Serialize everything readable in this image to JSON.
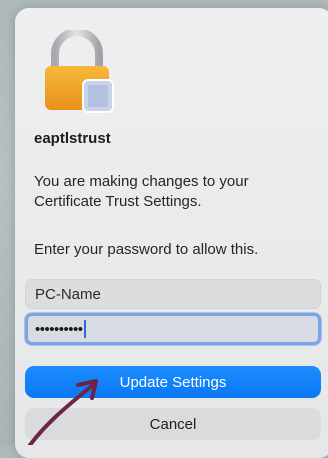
{
  "dialog": {
    "app_name": "eaptlstrust",
    "message": "You are making changes to your Certificate Trust Settings.",
    "instruction": "Enter your password to allow this.",
    "username_value": "PC-Name",
    "password_value": "••••••••••",
    "primary_button": "Update Settings",
    "secondary_button": "Cancel",
    "icon": "lock-icon"
  },
  "colors": {
    "primary_button": "#0a7cff",
    "focus_ring": "#7aa4e4",
    "annotation_arrow": "#6e2446"
  }
}
